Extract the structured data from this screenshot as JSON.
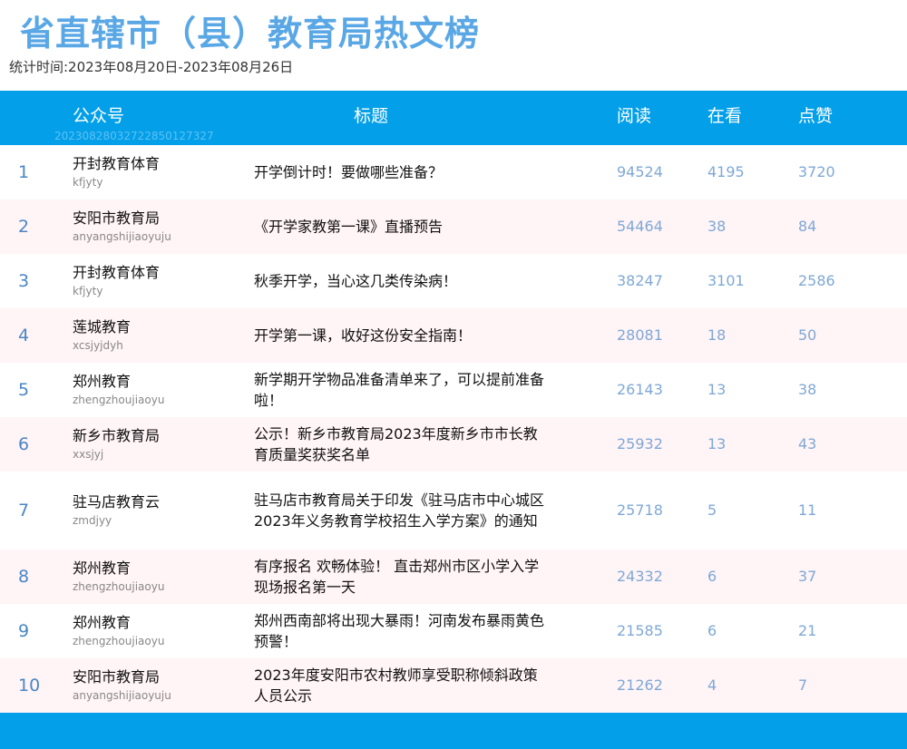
{
  "title": "省直辖市（县）教育局热文榜",
  "subtitle": "统计时间:2023年08月20日-2023年08月26日",
  "header": {
    "account": "公众号",
    "title": "标题",
    "reads": "阅读",
    "looking": "在看",
    "likes": "点赞",
    "watermark": "20230828032722850127327"
  },
  "rows": [
    {
      "rank": "1",
      "name": "开封教育体育",
      "id": "kfjyty",
      "title": "开学倒计时！要做哪些准备？",
      "reads": "94524",
      "looking": "4195",
      "likes": "3720"
    },
    {
      "rank": "2",
      "name": "安阳市教育局",
      "id": "anyangshijiaoyuju",
      "title": "《开学家教第一课》直播预告",
      "reads": "54464",
      "looking": "38",
      "likes": "84"
    },
    {
      "rank": "3",
      "name": "开封教育体育",
      "id": "kfjyty",
      "title": "秋季开学，当心这几类传染病！",
      "reads": "38247",
      "looking": "3101",
      "likes": "2586"
    },
    {
      "rank": "4",
      "name": "莲城教育",
      "id": "xcsjyjdyh",
      "title": "开学第一课，收好这份安全指南！",
      "reads": "28081",
      "looking": "18",
      "likes": "50"
    },
    {
      "rank": "5",
      "name": "郑州教育",
      "id": "zhengzhoujiaoyu",
      "title": "新学期开学物品准备清单来了，可以提前准备啦！",
      "reads": "26143",
      "looking": "13",
      "likes": "38"
    },
    {
      "rank": "6",
      "name": "新乡市教育局",
      "id": "xxsjyj",
      "title": "公示！新乡市教育局2023年度新乡市市长教育质量奖获奖名单",
      "reads": "25932",
      "looking": "13",
      "likes": "43"
    },
    {
      "rank": "7",
      "name": "驻马店教育云",
      "id": "zmdjyy",
      "title": "驻马店市教育局关于印发《驻马店市中心城区2023年义务教育学校招生入学方案》的通知",
      "reads": "25718",
      "looking": "5",
      "likes": "11"
    },
    {
      "rank": "8",
      "name": "郑州教育",
      "id": "zhengzhoujiaoyu",
      "title": "有序报名 欢畅体验！ 直击郑州市区小学入学现场报名第一天",
      "reads": "24332",
      "looking": "6",
      "likes": "37"
    },
    {
      "rank": "9",
      "name": "郑州教育",
      "id": "zhengzhoujiaoyu",
      "title": "郑州西南部将出现大暴雨！河南发布暴雨黄色预警！",
      "reads": "21585",
      "looking": "6",
      "likes": "21"
    },
    {
      "rank": "10",
      "name": "安阳市教育局",
      "id": "anyangshijiaoyuju",
      "title": "2023年度安阳市农村教师享受职称倾斜政策人员公示",
      "reads": "21262",
      "looking": "4",
      "likes": "7"
    }
  ]
}
